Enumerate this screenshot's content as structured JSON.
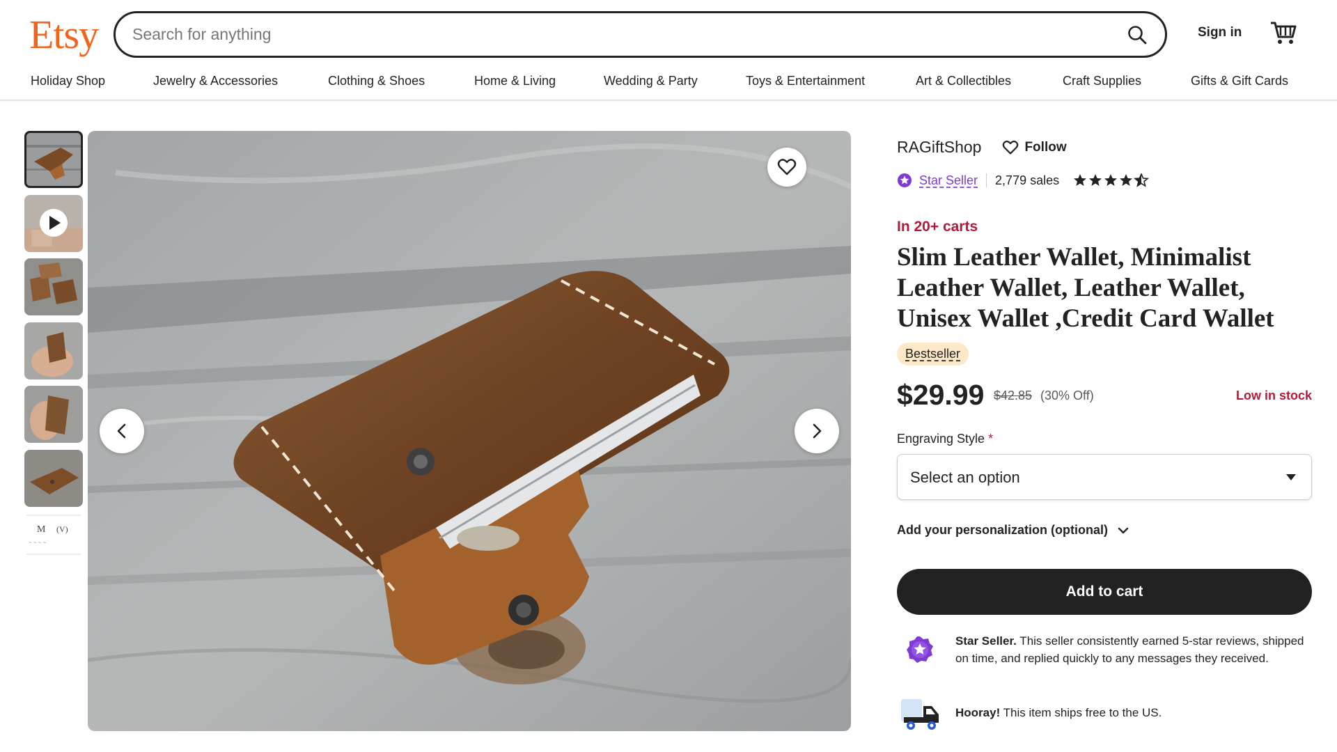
{
  "header": {
    "logo": "Etsy",
    "search_placeholder": "Search for anything",
    "sign_in": "Sign in"
  },
  "categories": [
    "Holiday Shop",
    "Jewelry & Accessories",
    "Clothing & Shoes",
    "Home & Living",
    "Wedding & Party",
    "Toys & Entertainment",
    "Art & Collectibles",
    "Craft Supplies",
    "Gifts & Gift Cards"
  ],
  "shop": {
    "name": "RAGiftShop",
    "follow_label": "Follow",
    "star_seller_label": "Star Seller",
    "sales": "2,779 sales",
    "rating_stars": 4.5
  },
  "product": {
    "cart_notice": "In 20+ carts",
    "title": "Slim Leather Wallet, Minimalist Leather Wallet, Leather Wallet, Unisex Wallet ,Credit Card Wallet",
    "badge": "Bestseller",
    "price": "$29.99",
    "original_price": "$42.85",
    "discount": "(30% Off)",
    "stock_status": "Low in stock"
  },
  "options": {
    "engraving_label": "Engraving Style",
    "required_marker": "*",
    "engraving_value": "Select an option",
    "personalization_label": "Add your personalization (optional)"
  },
  "actions": {
    "add_to_cart": "Add to cart"
  },
  "perks": {
    "star_seller_title": "Star Seller.",
    "star_seller_text": " This seller consistently earned 5-star reviews, shipped on time, and replied quickly to any messages they received.",
    "shipping_title": "Hooray!",
    "shipping_text": " This item ships free to the US."
  },
  "icons": {
    "search": "search-icon",
    "cart": "cart-icon",
    "favorite": "heart-icon",
    "prev": "chevron-left-icon",
    "next": "chevron-right-icon",
    "play": "play-icon",
    "star_seller": "star-seller-badge-icon",
    "shipping": "truck-icon"
  },
  "colors": {
    "brand": "#f1641e",
    "star_seller": "#7d3bd3",
    "alert": "#b3193a",
    "bestseller_bg": "#fde8c7",
    "button": "#222222"
  }
}
